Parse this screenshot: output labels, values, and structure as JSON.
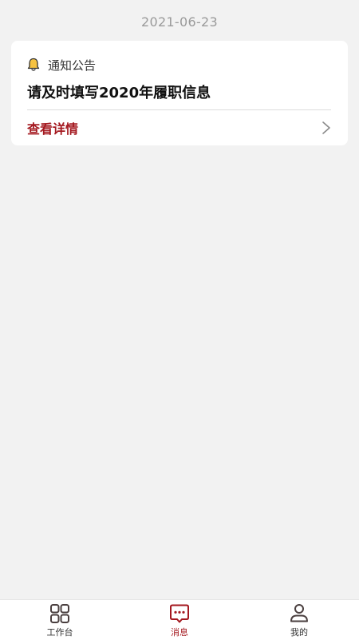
{
  "date": "2021-06-23",
  "notice": {
    "category": "通知公告",
    "title": "请及时填写2020年履职信息",
    "detail_label": "查看详情",
    "icon": "bell-icon"
  },
  "tabs": [
    {
      "label": "工作台",
      "icon": "grid-icon",
      "active": false
    },
    {
      "label": "消息",
      "icon": "message-icon",
      "active": true
    },
    {
      "label": "我的",
      "icon": "user-icon",
      "active": false
    }
  ],
  "colors": {
    "accent": "#a4181f",
    "background": "#f2f2f2",
    "card": "#ffffff",
    "muted_text": "#9a9a9a"
  }
}
